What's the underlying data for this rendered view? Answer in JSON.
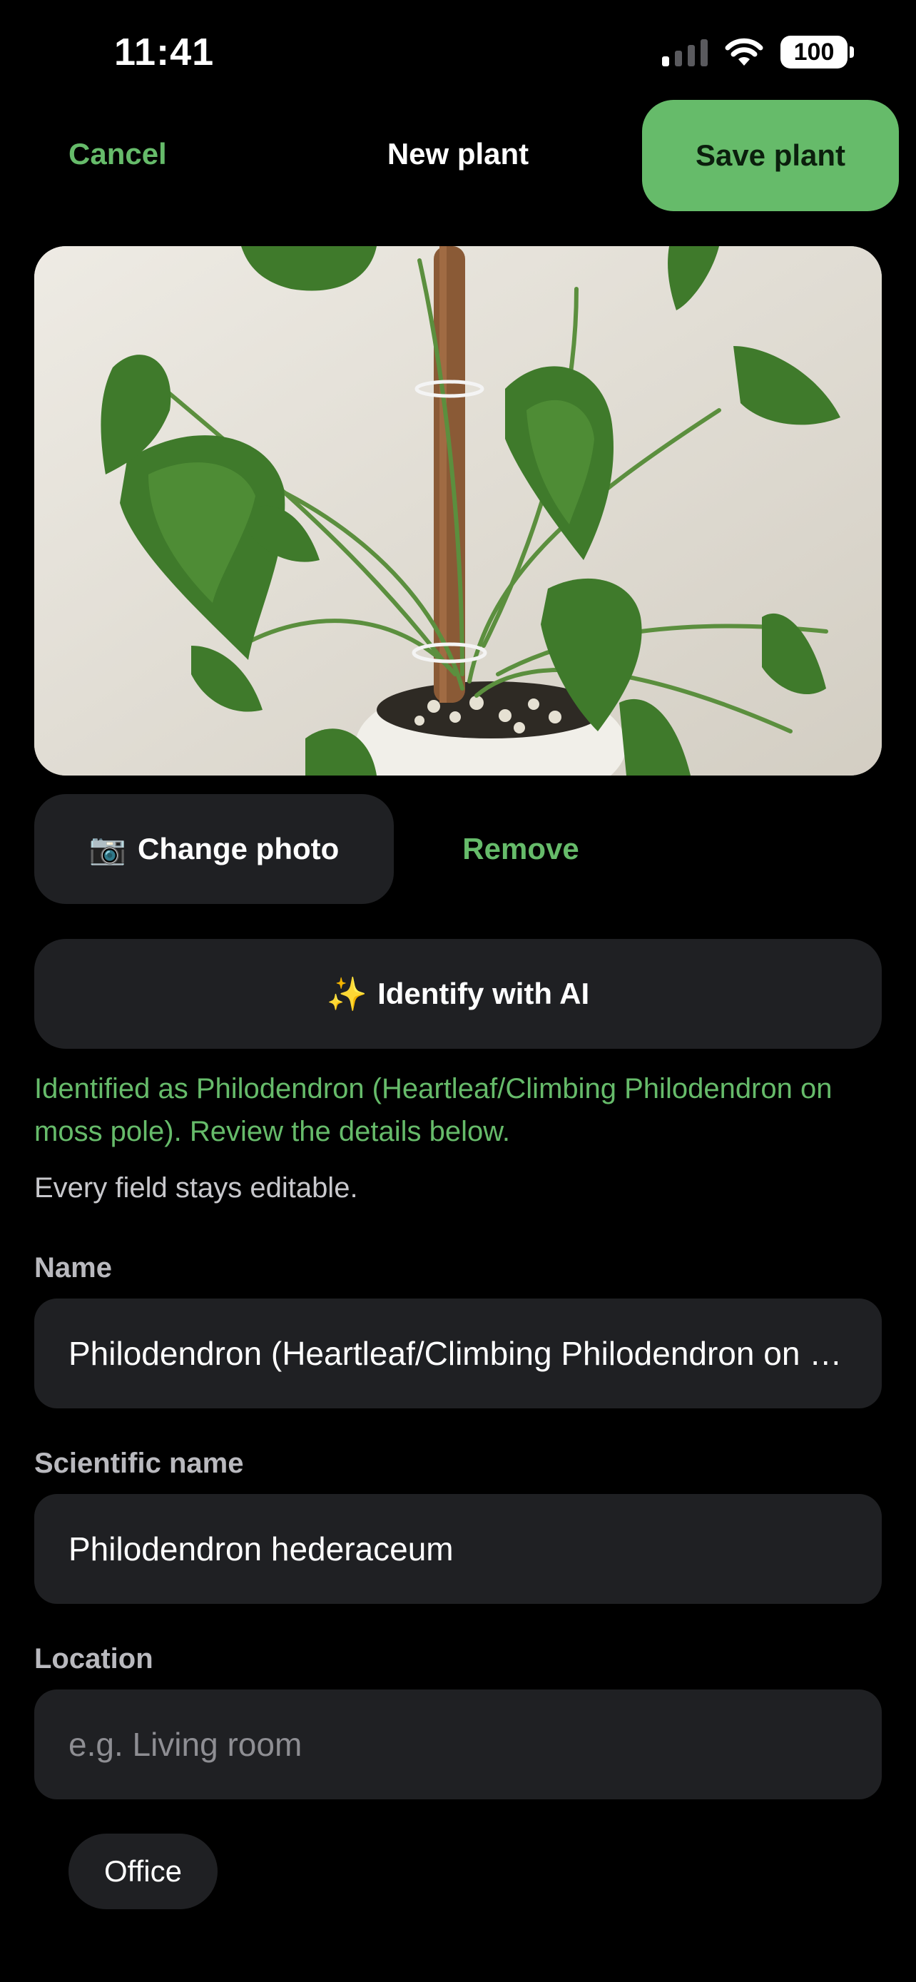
{
  "status_bar": {
    "time": "11:41",
    "battery": "100"
  },
  "nav": {
    "cancel_label": "Cancel",
    "title": "New plant",
    "save_label": "Save plant"
  },
  "photo_actions": {
    "change_icon": "📷",
    "change_label": "Change photo",
    "remove_label": "Remove"
  },
  "identify": {
    "icon": "✨",
    "label": "Identify with AI"
  },
  "ai_result": "Identified as Philodendron (Heartleaf/Climbing Philodendron on moss pole). Review the details below.",
  "hint": "Every field stays editable.",
  "fields": {
    "name": {
      "label": "Name",
      "value": "Philodendron (Heartleaf/Climbing Philodendron on moss pole)"
    },
    "scientific_name": {
      "label": "Scientific name",
      "value": "Philodendron hederaceum"
    },
    "location": {
      "label": "Location",
      "value": "",
      "placeholder": "e.g. Living room"
    }
  },
  "location_suggestions": [
    "Office"
  ],
  "colors": {
    "accent": "#66bb6a",
    "surface": "#1f2023",
    "background": "#000000"
  },
  "icons": [
    "cellular-signal-icon",
    "wifi-icon",
    "battery-icon",
    "camera-icon",
    "sparkles-icon"
  ]
}
